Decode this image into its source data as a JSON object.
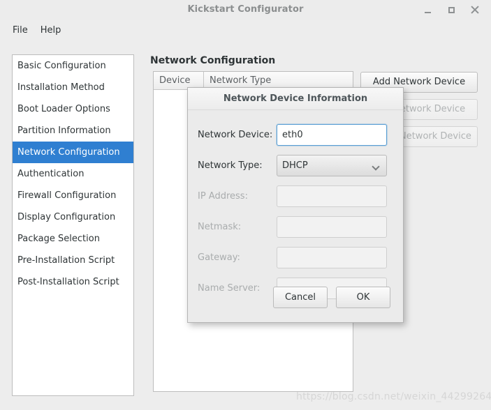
{
  "window": {
    "title": "Kickstart Configurator",
    "controls": {
      "minimize": "minimize-icon",
      "maximize": "maximize-icon",
      "close": "close-icon"
    }
  },
  "menubar": {
    "items": [
      {
        "label": "File"
      },
      {
        "label": "Help"
      }
    ]
  },
  "sidebar": {
    "items": [
      {
        "label": "Basic Configuration",
        "selected": false
      },
      {
        "label": "Installation Method",
        "selected": false
      },
      {
        "label": "Boot Loader Options",
        "selected": false
      },
      {
        "label": "Partition Information",
        "selected": false
      },
      {
        "label": "Network Configuration",
        "selected": true
      },
      {
        "label": "Authentication",
        "selected": false
      },
      {
        "label": "Firewall Configuration",
        "selected": false
      },
      {
        "label": "Display Configuration",
        "selected": false
      },
      {
        "label": "Package Selection",
        "selected": false
      },
      {
        "label": "Pre-Installation Script",
        "selected": false
      },
      {
        "label": "Post-Installation Script",
        "selected": false
      }
    ],
    "selected_color": "#2f7fd1"
  },
  "main": {
    "title": "Network Configuration",
    "table": {
      "columns": [
        "Device",
        "Network Type"
      ],
      "rows": []
    },
    "actions": [
      {
        "label": "Add Network Device",
        "enabled": true
      },
      {
        "label": "Edit Network Device",
        "enabled": false
      },
      {
        "label": "Delete Network Device",
        "enabled": false
      }
    ]
  },
  "dialog": {
    "title": "Network Device Information",
    "fields": [
      {
        "label": "Network Device:",
        "value": "eth0",
        "type": "text",
        "enabled": true,
        "focused": true
      },
      {
        "label": "Network Type:",
        "value": "DHCP",
        "type": "select",
        "enabled": true,
        "focused": false
      },
      {
        "label": "IP Address:",
        "value": "",
        "type": "text",
        "enabled": false,
        "focused": false
      },
      {
        "label": "Netmask:",
        "value": "",
        "type": "text",
        "enabled": false,
        "focused": false
      },
      {
        "label": "Gateway:",
        "value": "",
        "type": "text",
        "enabled": false,
        "focused": false
      },
      {
        "label": "Name Server:",
        "value": "",
        "type": "text",
        "enabled": false,
        "focused": false
      }
    ],
    "buttons": [
      {
        "label": "Cancel"
      },
      {
        "label": "OK"
      }
    ]
  },
  "watermark": "https://blog.csdn.net/weixin_44299264"
}
